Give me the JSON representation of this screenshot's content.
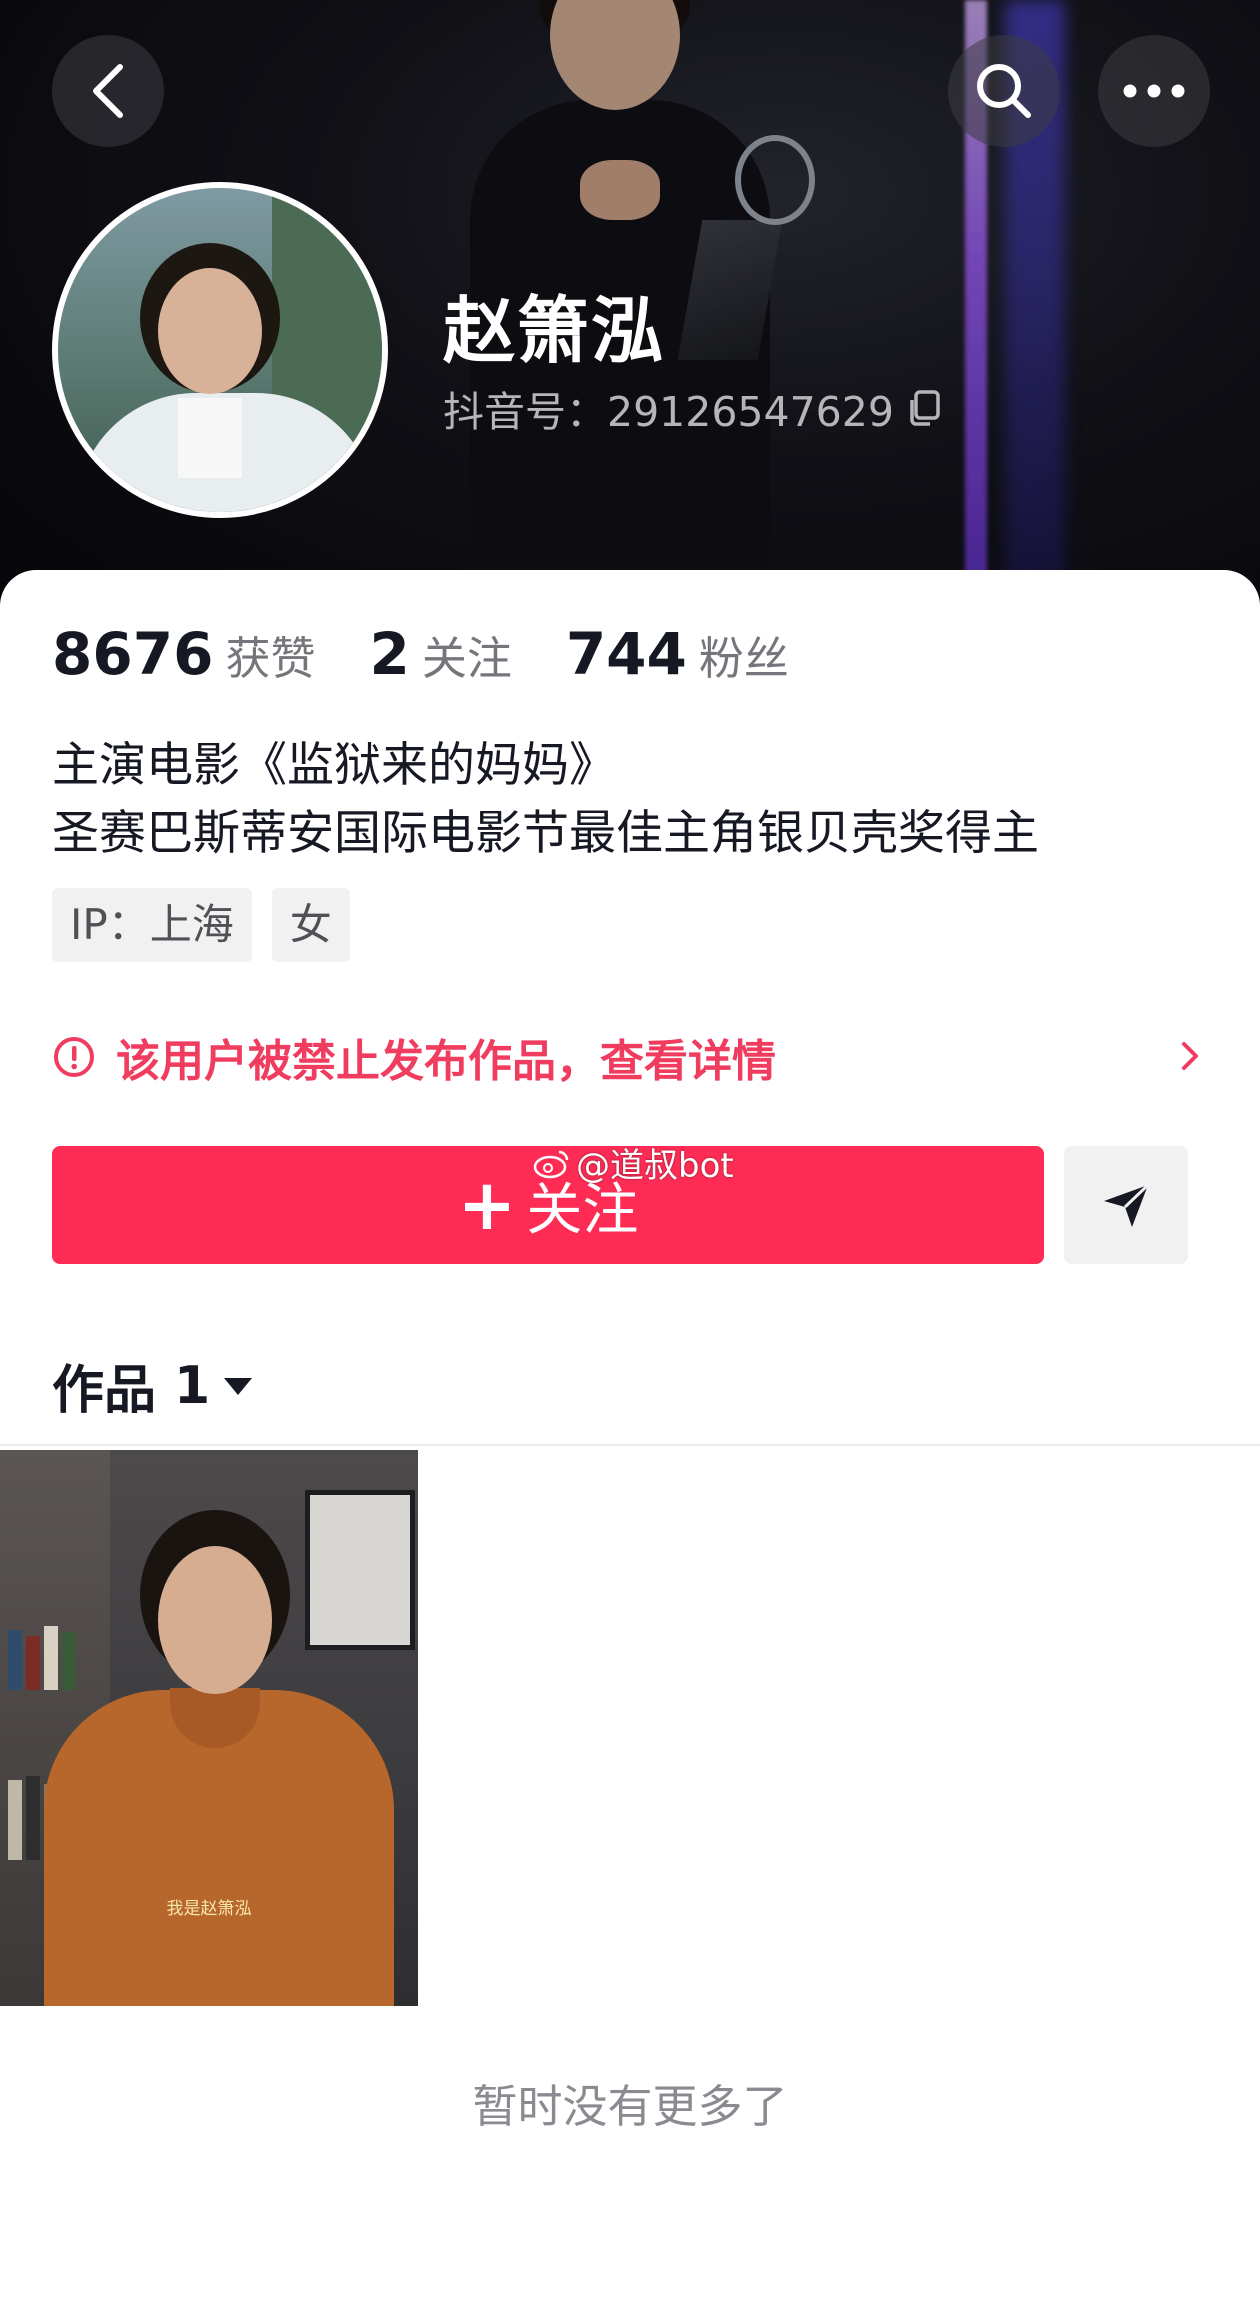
{
  "header": {
    "back_icon": "chevron-left-icon",
    "search_icon": "search-icon",
    "more_icon": "more-dots-icon"
  },
  "profile": {
    "name": "赵箫泓",
    "douyin_id": "抖音号：29126547629"
  },
  "stats": [
    {
      "value": "8676",
      "label": "获赞"
    },
    {
      "value": "2",
      "label": "关注"
    },
    {
      "value": "744",
      "label": "粉丝"
    }
  ],
  "bio": {
    "line1": "主演电影《监狱来的妈妈》",
    "line2": "圣赛巴斯蒂安国际电影节最佳主角银贝壳奖得主"
  },
  "tags": [
    "IP：上海",
    "女"
  ],
  "notice": {
    "text": "该用户被禁止发布作品，查看详情",
    "color": "#f03d5f"
  },
  "actions": {
    "follow_label": "关注",
    "follow_color": "#fe2c55"
  },
  "watermark": "@道叔bot",
  "works": {
    "label": "作品",
    "count": "1",
    "items": [
      {
        "caption": "我是赵箫泓"
      }
    ]
  },
  "footer": {
    "end_text": "暂时没有更多了"
  }
}
